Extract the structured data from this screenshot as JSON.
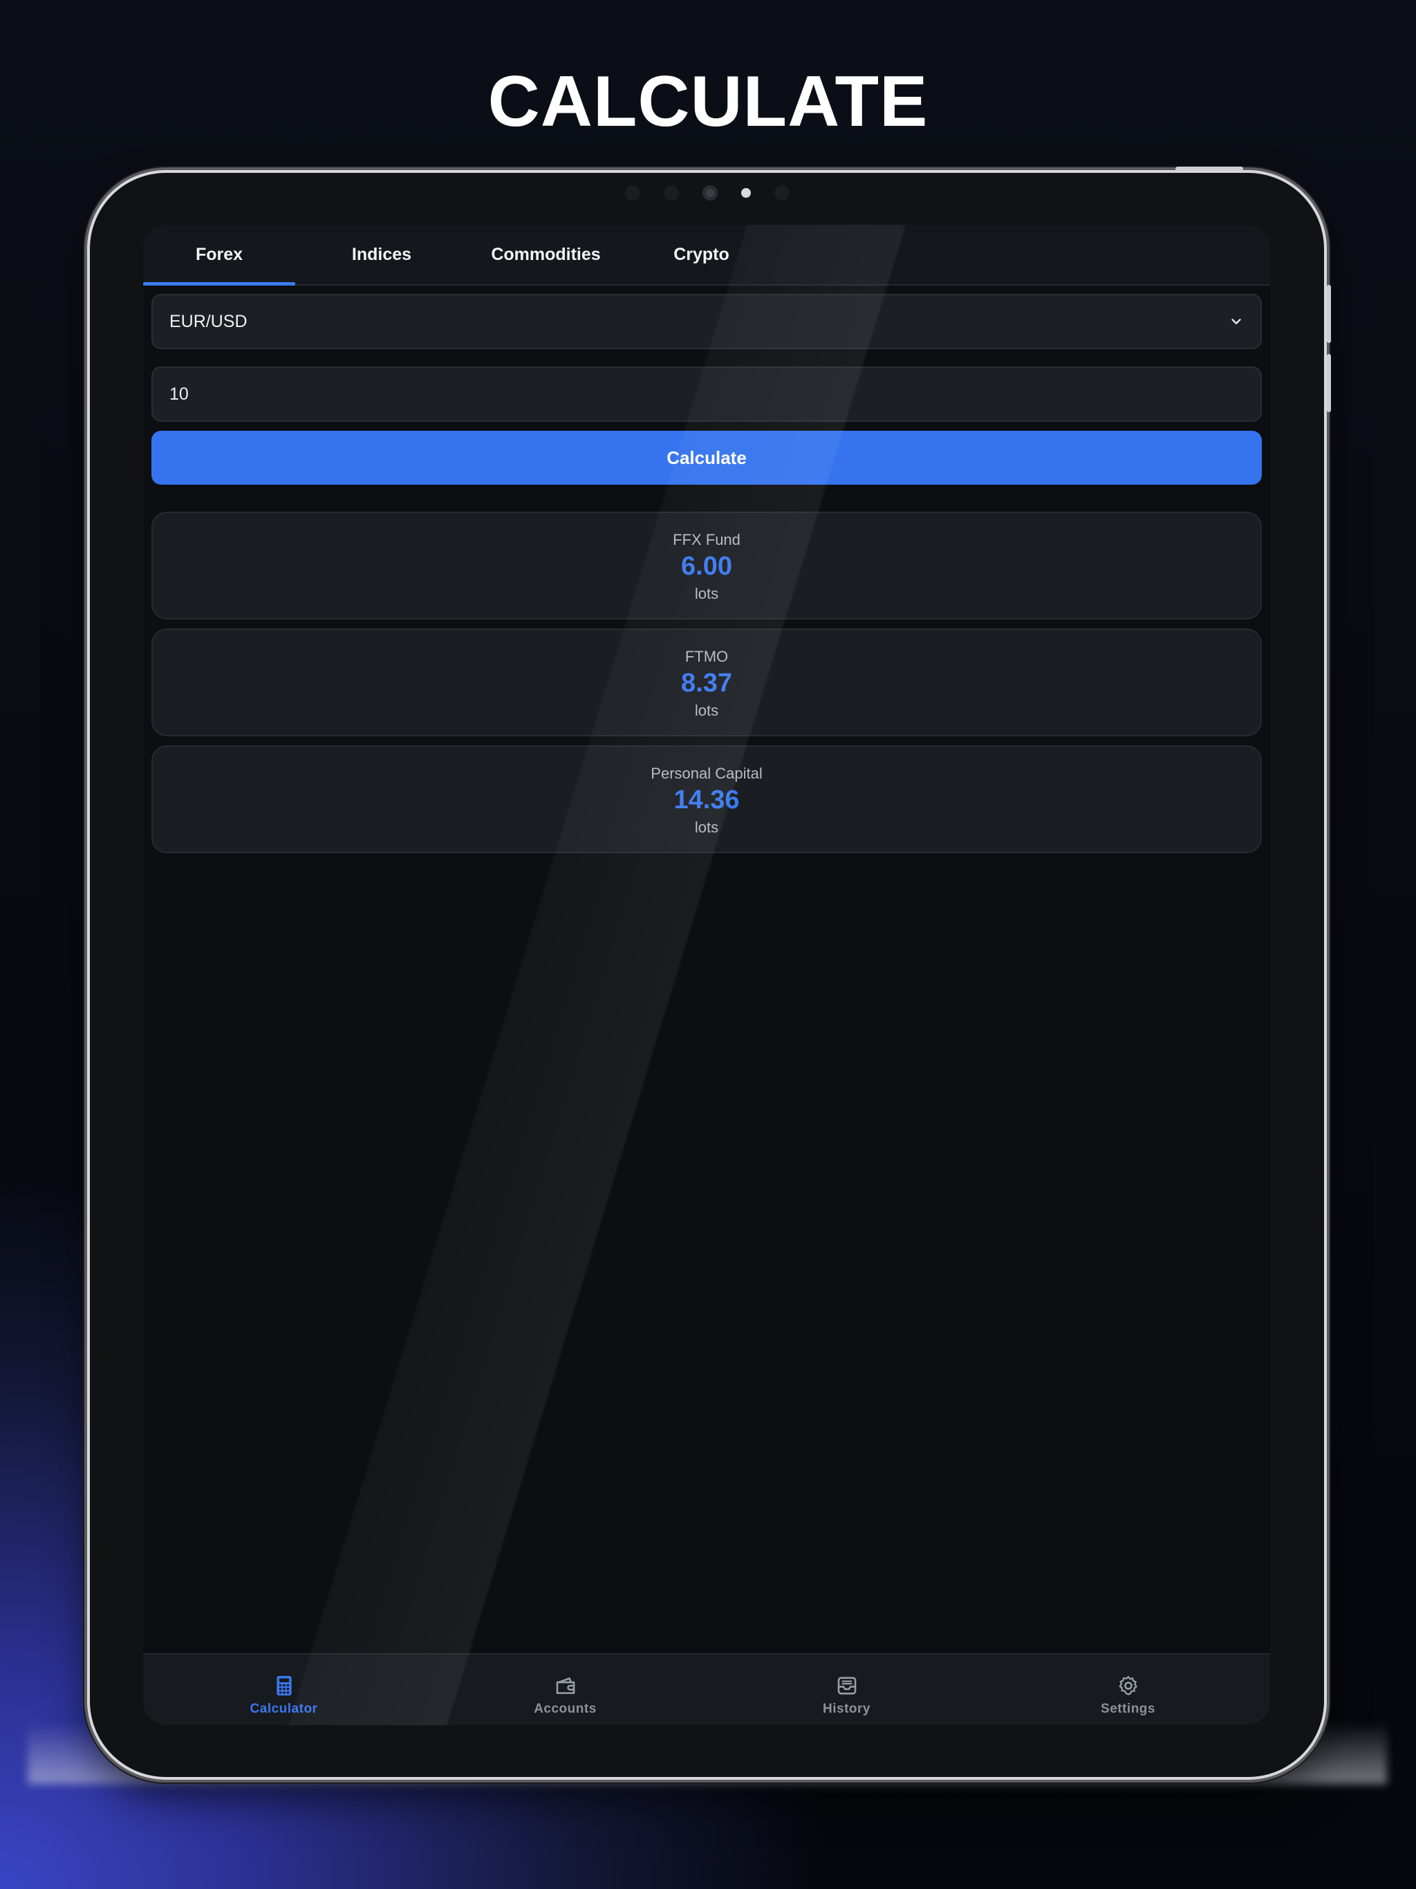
{
  "headline": "CALCULATE",
  "tabs": [
    {
      "label": "Forex",
      "active": true
    },
    {
      "label": "Indices",
      "active": false
    },
    {
      "label": "Commodities",
      "active": false
    },
    {
      "label": "Crypto",
      "active": false
    }
  ],
  "pair_select": {
    "value": "EUR/USD",
    "icon": "chevron-down-icon"
  },
  "amount_input": {
    "value": "10"
  },
  "calculate_button": {
    "label": "Calculate"
  },
  "results": [
    {
      "name": "FFX Fund",
      "value": "6.00",
      "unit": "lots"
    },
    {
      "name": "FTMO",
      "value": "8.37",
      "unit": "lots"
    },
    {
      "name": "Personal Capital",
      "value": "14.36",
      "unit": "lots"
    }
  ],
  "bottom_nav": [
    {
      "label": "Calculator",
      "icon": "calculator-icon",
      "active": true
    },
    {
      "label": "Accounts",
      "icon": "wallet-icon",
      "active": false
    },
    {
      "label": "History",
      "icon": "inbox-icon",
      "active": false
    },
    {
      "label": "Settings",
      "icon": "gear-icon",
      "active": false
    }
  ],
  "colors": {
    "accent": "#3574ee",
    "background": "#0c0e11",
    "card": "#1a1d22"
  }
}
